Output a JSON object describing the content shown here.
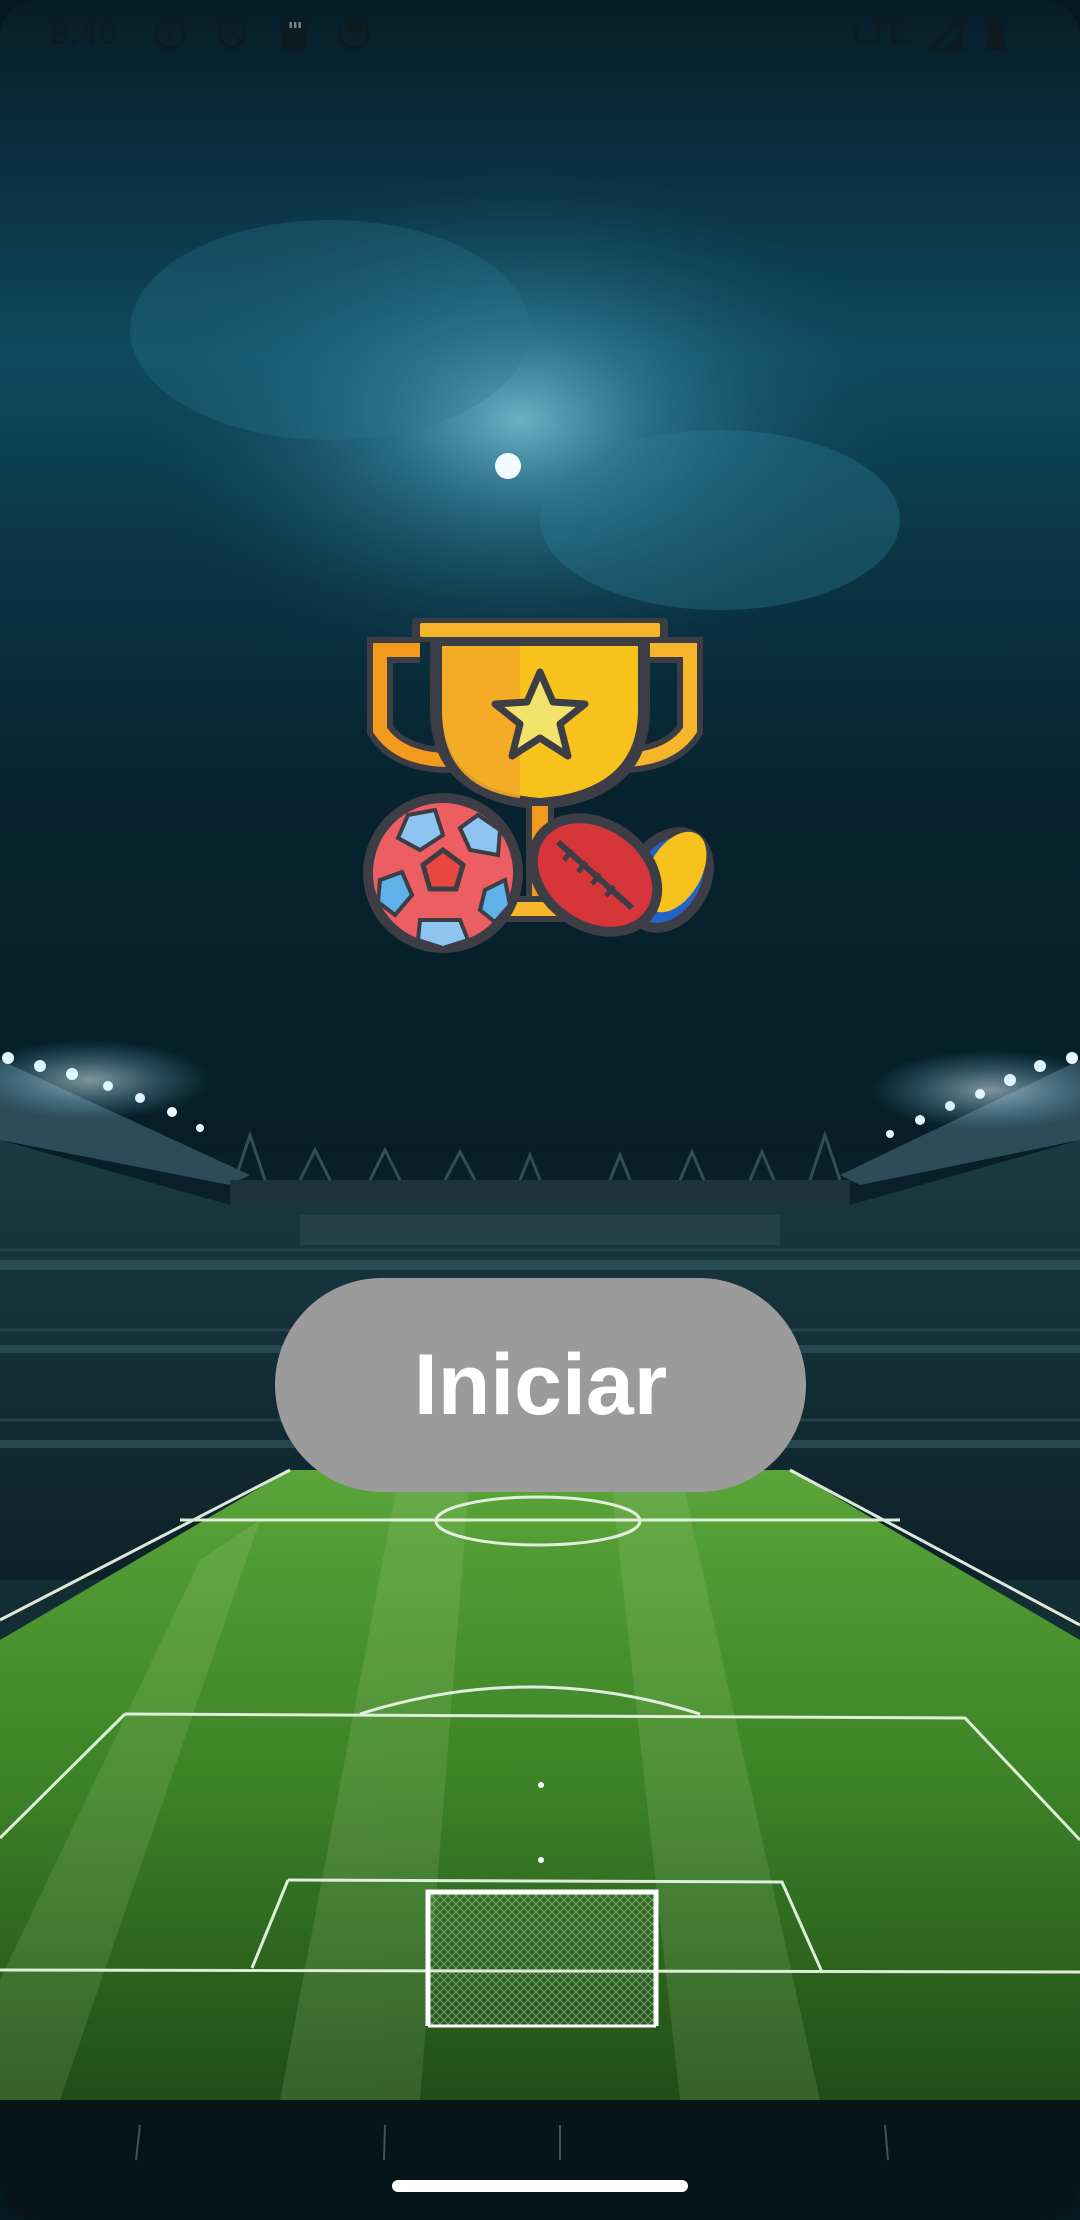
{
  "status_bar": {
    "time": "9:40",
    "network": "LTE",
    "icons": [
      "info-icon",
      "shield-icon",
      "sd-card-icon",
      "sync-icon",
      "signal-icon",
      "battery-icon"
    ]
  },
  "main": {
    "logo_icon": "trophy-with-balls-icon",
    "start_button_label": "Iniciar"
  },
  "colors": {
    "button_bg": "#9b9b9b",
    "button_text": "#ffffff",
    "pitch_green": "#3f8a2a",
    "sky_teal": "#0e4a5e"
  }
}
